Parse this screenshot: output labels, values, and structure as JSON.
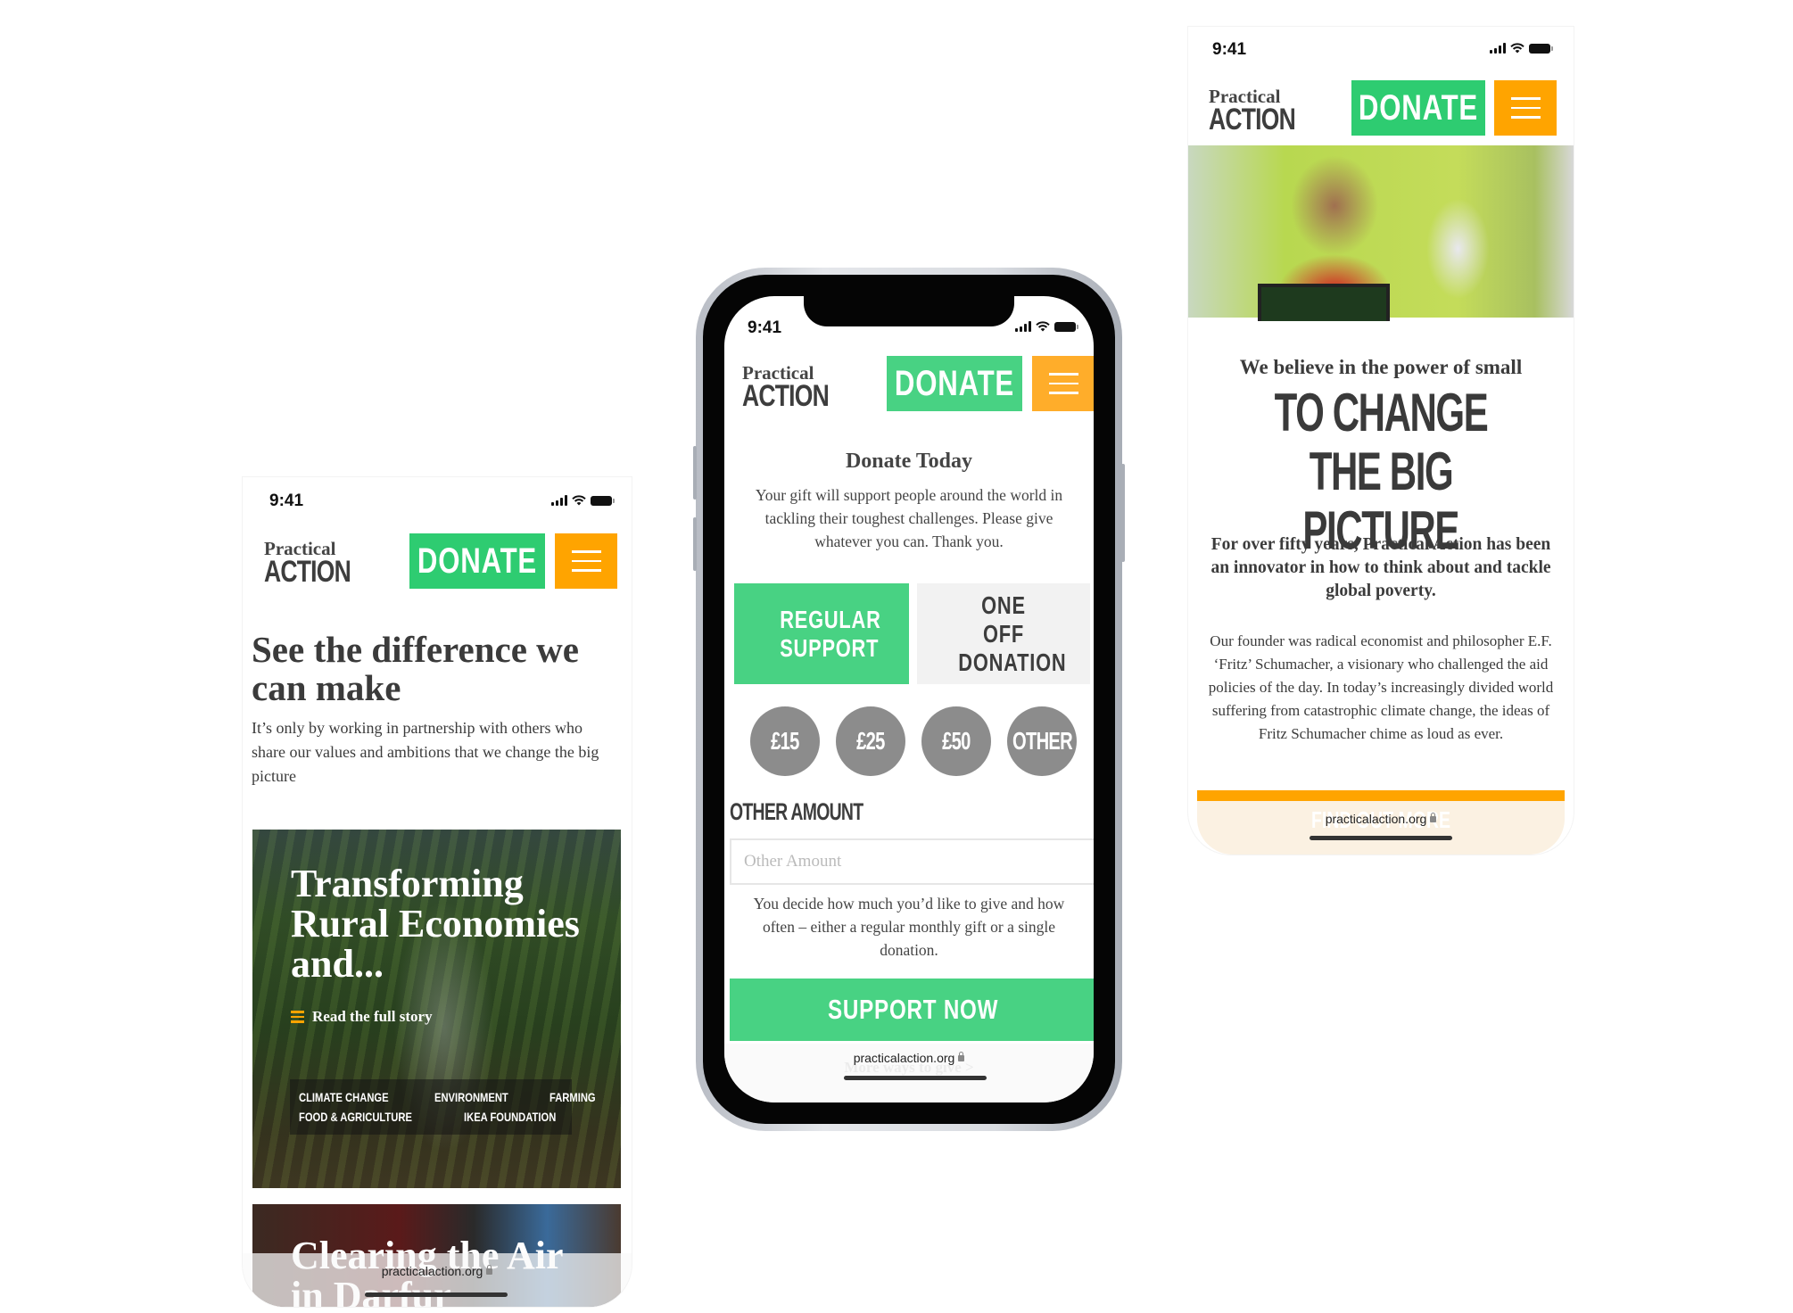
{
  "common": {
    "status_time": "9:41",
    "logo_line1": "Practical",
    "logo_line2": "ACTION",
    "donate_label": "DONATE",
    "url": "practicalaction.org",
    "colors": {
      "green": "#2ecc71",
      "button_green": "#48d283",
      "orange": "#ffa400",
      "text": "#3b3b3b",
      "amount_grey": "#8c8c8c"
    }
  },
  "left_phone": {
    "headline": "See the difference we can make",
    "intro": "It’s only by working in partnership with others who share our values and ambitions that we change the big picture",
    "stories": [
      {
        "title": "Transforming Rural Economies and...",
        "link": "Read the full story",
        "tags": [
          "CLIMATE CHANGE",
          "ENVIRONMENT",
          "FARMING",
          "FOOD & AGRICULTURE",
          "IKEA FOUNDATION"
        ]
      },
      {
        "title": "Clearing the Air in Darfur"
      }
    ]
  },
  "middle_phone": {
    "heading": "Donate Today",
    "intro": "Your gift will support people around the world in tackling their toughest challenges. Please give whatever you can. Thank you.",
    "toggle": {
      "options": [
        "REGULAR SUPPORT",
        "ONE OFF DONATION"
      ],
      "selected": "REGULAR SUPPORT"
    },
    "amounts": [
      "£15",
      "£25",
      "£50",
      "OTHER"
    ],
    "other_amount_label": "OTHER AMOUNT",
    "other_amount_placeholder": "Other Amount",
    "other_amount_value": "",
    "explainer": "You decide how much you’d like to give and how often – either a regular monthly gift or a single donation.",
    "submit_label": "SUPPORT NOW",
    "more_ways": "More ways to give >"
  },
  "right_phone": {
    "subheading": "We believe in the power of small",
    "big_heading_line1": "TO CHANGE THE BIG",
    "big_heading_line2": "PICTURE",
    "lead": "For over fifty years, Practical Action has been an innovator in how to think about and tackle global poverty.",
    "body": "Our founder was radical economist and philosopher E.F. ‘Fritz’ Schumacher, a visionary who challenged the aid policies of the day. In today’s increasingly divided world suffering from catastrophic climate change, the ideas of Fritz Schumacher chime as loud as ever.",
    "cta": "FIND OUT MORE"
  }
}
